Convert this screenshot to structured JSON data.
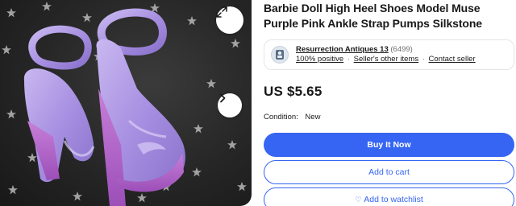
{
  "listing": {
    "title": "Barbie Doll High Heel Shoes Model Muse Purple Pink Ankle Strap Pumps Silkstone",
    "photo_alt": "Purple high heel doll shoes on star-patterned background"
  },
  "icons": {
    "expand": "expand-icon",
    "next": "chevron-right-icon",
    "heart": "heart-icon"
  },
  "seller": {
    "name": "Resurrection Antiques 13",
    "feedback_count": "(6499)",
    "positive": "100% positive",
    "other_items": "Seller's other items",
    "contact": "Contact seller",
    "separator": "·"
  },
  "price": "US $5.65",
  "condition": {
    "label": "Condition:",
    "value": "New"
  },
  "actions": {
    "buy_now": "Buy It Now",
    "add_to_cart": "Add to cart",
    "add_to_watchlist": "Add to watchlist"
  },
  "colors": {
    "primary": "#3665f3",
    "text": "#191919",
    "muted": "#707070"
  }
}
